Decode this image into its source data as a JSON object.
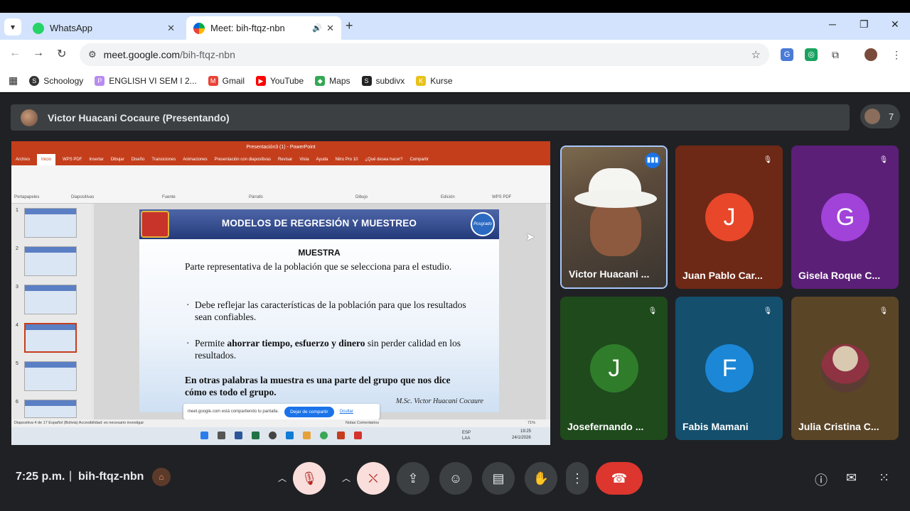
{
  "browser": {
    "tabs": [
      {
        "title": "WhatsApp",
        "close": "✕",
        "active": false
      },
      {
        "title": "Meet: bih-ftqz-nbn",
        "close": "✕",
        "speaker": "🔊",
        "active": true
      }
    ],
    "new_tab": "+",
    "url_domain": "meet.google.com",
    "url_path": "/bih-ftqz-nbn",
    "bookmarks": [
      "Schoology",
      "ENGLISH VI SEM I 2...",
      "Gmail",
      "YouTube",
      "Maps",
      "subdivx",
      "Kurse"
    ]
  },
  "meet": {
    "presenter_label": "Victor Huacani Cocaure (Presentando)",
    "participant_count": "7",
    "time": "7:25 p.m.",
    "separator": "|",
    "meeting_code": "bih-ftqz-nbn",
    "participants": [
      {
        "name": "Victor Huacani ...",
        "initial": "",
        "color": "",
        "muted": false
      },
      {
        "name": "Juan Pablo Car...",
        "initial": "J",
        "color": "#e8472a",
        "muted": true
      },
      {
        "name": "Gisela Roque C...",
        "initial": "G",
        "color": "#a142d9",
        "muted": true
      },
      {
        "name": "Josefernando ...",
        "initial": "J",
        "color": "#2f7d2b",
        "muted": true
      },
      {
        "name": "Fabis Mamani",
        "initial": "F",
        "color": "#1b87d6",
        "muted": true
      },
      {
        "name": "Julia Cristina C...",
        "initial": "",
        "color": "",
        "muted": true
      }
    ],
    "tile_colors": [
      "#4a3b2e",
      "#6e2816",
      "#5b1f78",
      "#1f4a1c",
      "#144f6e",
      "#5a4527"
    ]
  },
  "shared_screen": {
    "window_title": "Presentación3 (1) - PowerPoint",
    "ribbon_tabs": [
      "Archivo",
      "Inicio",
      "WPS PDF",
      "Insertar",
      "Dibujar",
      "Diseño",
      "Transiciones",
      "Animaciones",
      "Presentación con diapositivas",
      "Revisar",
      "Vista",
      "Ayuda",
      "Nitro Pro 10",
      "¿Qué desea hacer?",
      "Compartir"
    ],
    "ribbon_groups": [
      "Portapapeles",
      "Diapositivas",
      "Fuente",
      "Párrafo",
      "Dibujo",
      "Edición",
      "WPS PDF"
    ],
    "thumb_numbers": [
      "1",
      "2",
      "3",
      "4",
      "5",
      "6"
    ],
    "slide": {
      "title": "MODELOS DE REGRESIÓN Y MUESTREO",
      "badge": "Posgrado",
      "subtitle": "MUESTRA",
      "definition": "Parte representativa de la población que se selecciona para el estudio.",
      "bullet1": "Debe reflejar las características de la población para que los resultados sean confiables.",
      "bullet2_pre": "Permite ",
      "bullet2_bold": "ahorrar tiempo, esfuerzo y dinero",
      "bullet2_post": " sin perder calidad en los resultados.",
      "conclusion": "En otras palabras la muestra es una parte del grupo que nos dice cómo es todo el grupo.",
      "signature": "M.Sc. Victor Huacani Cocaure"
    },
    "share_notice": "meet.google.com está compartiendo tu pantalla.",
    "stop_share": "Dejar de compartir",
    "hide": "Ocultar",
    "status": "Diapositiva 4 de 17     Español (Bolivia)     Accesibilidad: es necesario investigar",
    "status_right": "Notas   Comentarios",
    "zoom": "71%",
    "taskbar_clock": "19:25",
    "taskbar_date": "24/1/2026",
    "lang": "ESP LAA"
  }
}
